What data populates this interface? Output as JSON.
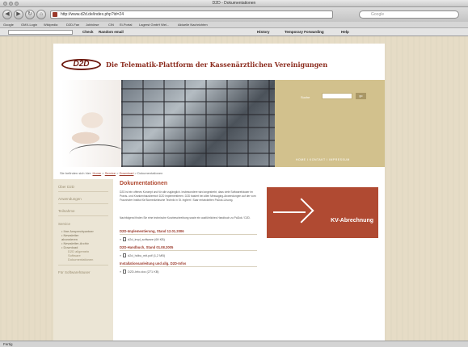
{
  "window": {
    "title": "D2D - Dokumentationen"
  },
  "toolbar": {
    "back_icon": "back-arrow-icon",
    "forward_icon": "forward-arrow-icon",
    "reload_icon": "reload-icon",
    "home_icon": "home-icon",
    "url": "http://www.d2d.de/index.php?id=24",
    "search_placeholder": "Google"
  },
  "bookmarks": [
    "Google",
    "GMX-Login",
    "Wikipedia",
    "D2D-Fan",
    "Jobbörse",
    "CIN",
    "Ei-Portal",
    "Lagerst GmbH Wel...",
    "Aktuelle Nachrichten"
  ],
  "google_toolbar": [
    "Check",
    "Random email",
    "History",
    "Temporary Forwarding",
    "Help"
  ],
  "header": {
    "logo_text": "D2D",
    "tagline": "Die Telematik-Plattform der Kassenärztlichen Vereinigungen"
  },
  "banner": {
    "search_label": "Suche",
    "search_button": "go",
    "top_links": "HOME  I  KONTAKT  I  IMPRESSUM"
  },
  "breadcrumb": {
    "prefix": "Sie befinden sich hier:",
    "home": "Home",
    "service": "Service",
    "download": "Download",
    "current": "Dokumentationen"
  },
  "sidebar": {
    "items": [
      "Über D2D",
      "Anwendungen",
      "Teilnahme",
      "Service",
      "Für Softwarehäuser"
    ],
    "service_sub": [
      "• Ihre Ansprechpartner",
      "• Newsletter",
      "  abonnieren",
      "• Newsletter-Archiv",
      "• Download"
    ],
    "download_sub": [
      "D2D allgemein",
      "Software",
      "Dokumentationen"
    ]
  },
  "content": {
    "title": "Dokumentationen",
    "para1": "D2D ist ein offenes Konzept und für alle zugänglich. Insbesondere wird angestrebt, dass viele Softwarehäuser im Praxis- und Krankenhausbereich D2D implementieren. D2D basiert bei allen Messaging-Anwendungen auf der vom Fraunhofer Institut für Biomedizinische Technik in St. Ingbert / Saar entwickelten PaDok-Lösung.",
    "para2": "Nachfolgend finden Sie eine technische Kurzbeschreibung sowie ein ausführliches Handbuch zu PaDok / D2D.",
    "sections": [
      {
        "head": "D2D-Implementierung, Stand 12.01.2006",
        "file": "d2d_impl_software (69 KB)"
      },
      {
        "head": "D2D-Handbuch, Stand 01.08.2005",
        "file": "d2d_hdbu_mit.pdf (1,2 MB)"
      },
      {
        "head": "Installationsanleitung und allg. D2D-Infos",
        "file": "D2D-Info.doc (271 KB)"
      }
    ]
  },
  "kv_box": {
    "label": "KV-Abrechnung"
  },
  "status": {
    "text": "Fertig"
  }
}
